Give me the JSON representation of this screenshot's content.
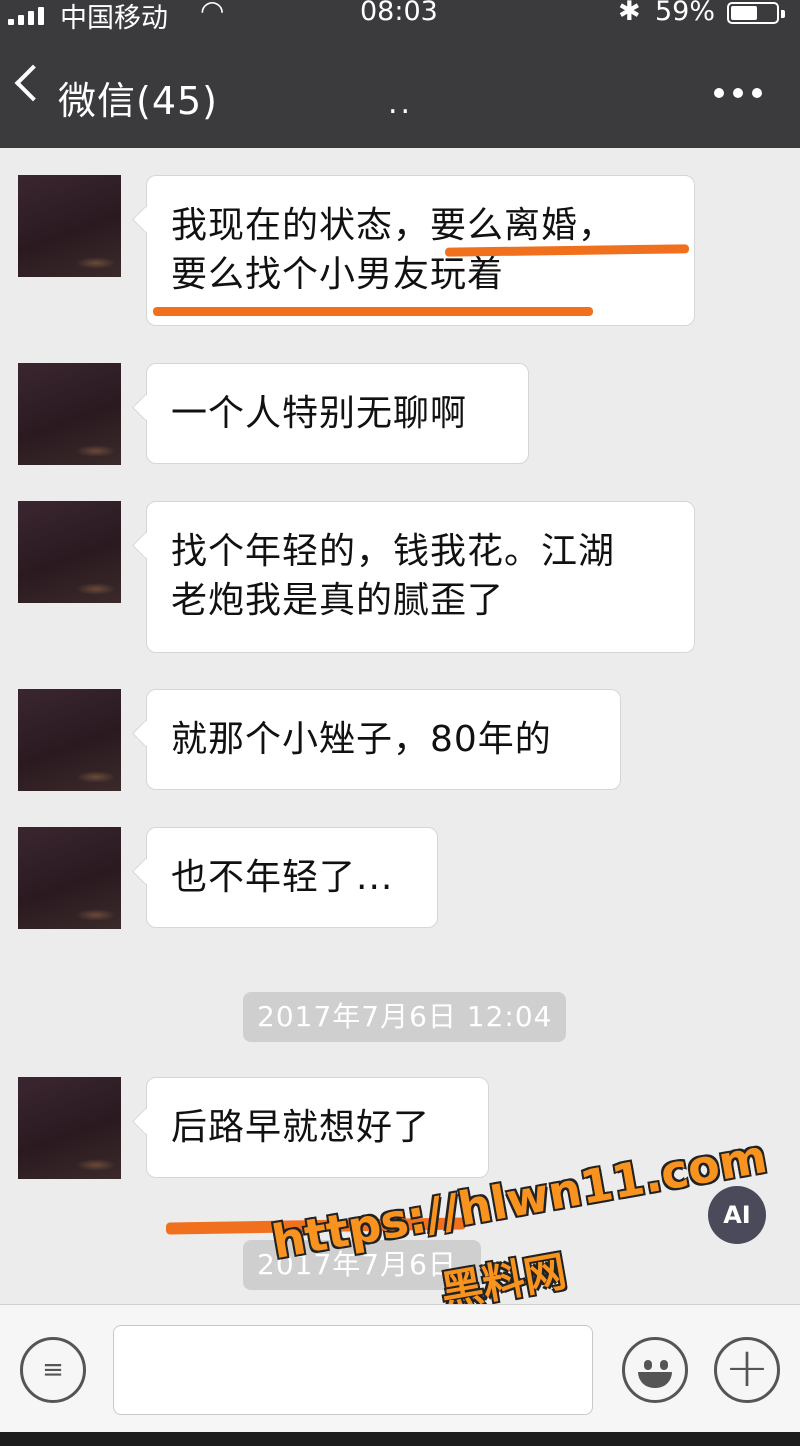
{
  "status_bar": {
    "carrier": "中国移动",
    "time": "08:03",
    "battery_percent": "59%",
    "battery_level": 0.59
  },
  "nav": {
    "back_label": "微信(45)",
    "typing_indicator": "..",
    "more_icon": "more-dots-icon"
  },
  "messages": [
    {
      "text": "我现在的状态，要么离婚，要么找个小男友玩着",
      "line1": "我现在的状态，要么离婚，",
      "line2": "要么找个小男友玩着"
    },
    {
      "text": "一个人特别无聊啊"
    },
    {
      "line1": "找个年轻的，钱我花。江湖",
      "line2": "老炮我是真的腻歪了"
    },
    {
      "text": "就那个小矬子，80年的"
    },
    {
      "text": "也不年轻了..."
    },
    {
      "text": "后路早就想好了"
    }
  ],
  "timestamps": [
    "2017年7月6日 12:04",
    "2017年7月6日"
  ],
  "watermark": {
    "url": "https://hlwn11.com",
    "site_name": "黑料网",
    "accent_color": "#f7931e"
  },
  "ai_badge": "AI",
  "input_bar": {
    "voice_icon": "voice-icon",
    "emoji_icon": "emoji-icon",
    "plus_icon": "plus-icon"
  },
  "colors": {
    "header_bg": "#3b3b3d",
    "chat_bg": "#ececec",
    "highlight": "#f0701e"
  }
}
